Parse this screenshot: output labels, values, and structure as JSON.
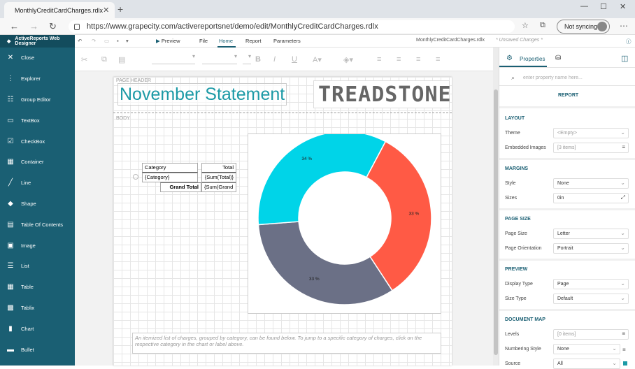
{
  "browser": {
    "tab_title": "MonthlyCreditCardCharges.rdlx",
    "new_tab": "+",
    "url": "https://www.grapecity.com/activereportsnet/demo/edit/MonthlyCreditCardCharges.rdlx",
    "sync": "Not syncing"
  },
  "app": {
    "name": "ActiveReports Web Designer",
    "menu": [
      "Preview",
      "File",
      "Home",
      "Report",
      "Parameters"
    ],
    "active_menu": "Home",
    "doc_title": "MonthlyCreditCardCharges.rdlx",
    "unsaved": "* Unsaved Changes *"
  },
  "sidebar": {
    "items": [
      {
        "label": "Close",
        "icon": "close-icon"
      },
      {
        "label": "Explorer",
        "icon": "explorer-icon"
      },
      {
        "label": "Group Editor",
        "icon": "group-editor-icon"
      },
      {
        "label": "TextBox",
        "icon": "textbox-icon"
      },
      {
        "label": "CheckBox",
        "icon": "checkbox-icon"
      },
      {
        "label": "Container",
        "icon": "container-icon"
      },
      {
        "label": "Line",
        "icon": "line-icon"
      },
      {
        "label": "Shape",
        "icon": "shape-icon"
      },
      {
        "label": "Table Of Contents",
        "icon": "toc-icon"
      },
      {
        "label": "Image",
        "icon": "image-icon"
      },
      {
        "label": "List",
        "icon": "list-icon"
      },
      {
        "label": "Table",
        "icon": "table-icon"
      },
      {
        "label": "Tablix",
        "icon": "tablix-icon"
      },
      {
        "label": "Chart",
        "icon": "chart-icon"
      },
      {
        "label": "Bullet",
        "icon": "bullet-icon"
      }
    ]
  },
  "report": {
    "page_header_label": "PAGE HEADER",
    "body_label": "BODY",
    "title": "November Statement",
    "logo_text": "TREADSTONE",
    "table": {
      "h_category": "Category",
      "h_total": "Total",
      "r_category": "{Category}",
      "r_total": "{Sum(Total)}",
      "f_label": "Grand Total",
      "f_value": "{Sum(Grand"
    },
    "note": "An itemized list of charges, grouped by category, can be found below. To jump to a specific category of charges, click on the respective category in the chart or label above."
  },
  "chart_data": {
    "type": "pie",
    "categories": [
      "Cyan",
      "Red",
      "Gray"
    ],
    "values": [
      34,
      33,
      33
    ],
    "labels": [
      "34 %",
      "33 %",
      "33 %"
    ],
    "colors": [
      "#00d4e8",
      "#ff5a45",
      "#6b7086"
    ]
  },
  "properties": {
    "tab_label": "Properties",
    "search_placeholder": "enter property name here...",
    "report_label": "REPORT",
    "sections": {
      "layout": "LAYOUT",
      "margins": "MARGINS",
      "page_size": "PAGE SIZE",
      "preview": "PREVIEW",
      "document_map": "DOCUMENT MAP"
    },
    "theme_label": "Theme",
    "theme_value": "<Empty>",
    "emb_label": "Embedded Images",
    "emb_value": "[3 items]",
    "style_label": "Style",
    "style_value": "None",
    "sizes_label": "Sizes",
    "sizes_value": "0in",
    "pagesize_label": "Page Size",
    "pagesize_value": "Letter",
    "orient_label": "Page Orientation",
    "orient_value": "Portrait",
    "display_label": "Display Type",
    "display_value": "Page",
    "sizetype_label": "Size Type",
    "sizetype_value": "Default",
    "levels_label": "Levels",
    "levels_value": "[0 items]",
    "numbering_label": "Numbering Style",
    "numbering_value": "None",
    "source_label": "Source",
    "source_value": "All"
  }
}
